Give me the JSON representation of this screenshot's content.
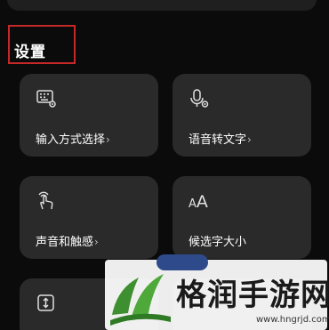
{
  "section": {
    "title": "设置"
  },
  "tiles": [
    {
      "label": "输入方式选择",
      "chevron": "›",
      "icon": "keyboard-settings-icon"
    },
    {
      "label": "语音转文字",
      "chevron": "›",
      "icon": "microphone-settings-icon"
    },
    {
      "label": "声音和触感",
      "chevron": "›",
      "icon": "touch-vibration-icon"
    },
    {
      "label": "候选字大小",
      "chevron": "›",
      "icon": "font-size-icon",
      "glyph_small": "A",
      "glyph_big": "A"
    },
    {
      "label": "",
      "icon": "vertical-resize-icon"
    },
    {
      "label": "",
      "icon": ""
    }
  ],
  "watermark": {
    "title": "格润手游网",
    "url": "www.hngrjd.com"
  },
  "colors": {
    "background": "#0b0b0b",
    "tile": "#2a2a2a",
    "highlight": "#c62828",
    "watermark_green": "#3e8f2f"
  }
}
